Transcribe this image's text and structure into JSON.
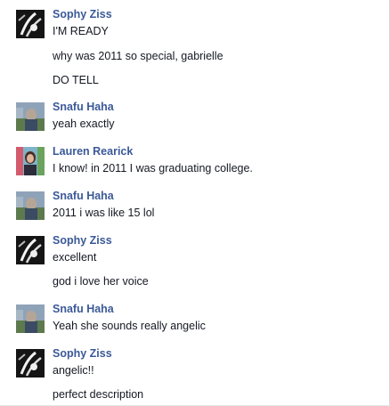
{
  "messages": [
    {
      "author": "Sophy Ziss",
      "avatar_icon": "sophy-ziss-avatar",
      "lines": [
        "I'M READY",
        "why was 2011 so special, gabrielle",
        "DO TELL"
      ]
    },
    {
      "author": "Snafu Haha",
      "avatar_icon": "snafu-haha-avatar",
      "lines": [
        "yeah exactly"
      ]
    },
    {
      "author": "Lauren Rearick",
      "avatar_icon": "lauren-rearick-avatar",
      "lines": [
        "I know! in 2011 I was graduating college."
      ]
    },
    {
      "author": "Snafu Haha",
      "avatar_icon": "snafu-haha-avatar",
      "lines": [
        "2011 i was like 15 lol"
      ]
    },
    {
      "author": "Sophy Ziss",
      "avatar_icon": "sophy-ziss-avatar",
      "lines": [
        "excellent",
        "god i love her voice"
      ]
    },
    {
      "author": "Snafu Haha",
      "avatar_icon": "snafu-haha-avatar",
      "lines": [
        "Yeah she sounds really angelic"
      ]
    },
    {
      "author": "Sophy Ziss",
      "avatar_icon": "sophy-ziss-avatar",
      "lines": [
        "angelic!!",
        "perfect description"
      ]
    }
  ],
  "colors": {
    "author_name": "#3b5998",
    "message_text": "#141823"
  }
}
